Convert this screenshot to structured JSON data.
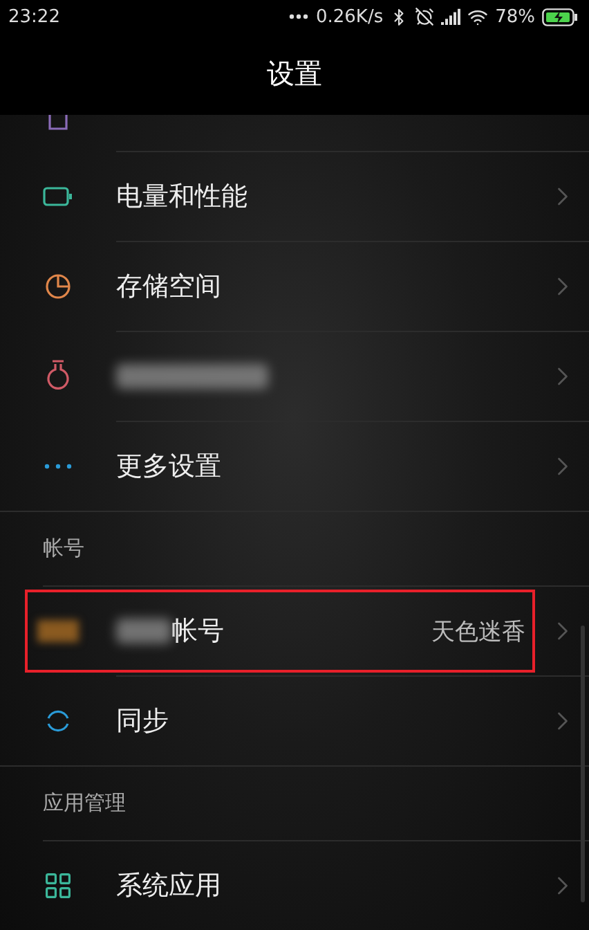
{
  "status_bar": {
    "time": "23:22",
    "speed": "0.26K/s",
    "battery": "78%"
  },
  "header": {
    "title": "设置"
  },
  "sections": [
    {
      "items": [
        {
          "kind": "cut"
        },
        {
          "kind": "item",
          "label": "电量和性能"
        },
        {
          "kind": "item",
          "label": "存储空间"
        },
        {
          "kind": "blurred"
        },
        {
          "kind": "item",
          "label": "更多设置"
        }
      ]
    },
    {
      "title": "帐号",
      "items": [
        {
          "kind": "account",
          "label": "帐号",
          "value": "天色迷香",
          "highlighted": true
        },
        {
          "kind": "item",
          "label": "同步",
          "highlighted": false
        }
      ]
    },
    {
      "title": "应用管理",
      "items": [
        {
          "kind": "item",
          "label": "系统应用"
        }
      ]
    }
  ]
}
